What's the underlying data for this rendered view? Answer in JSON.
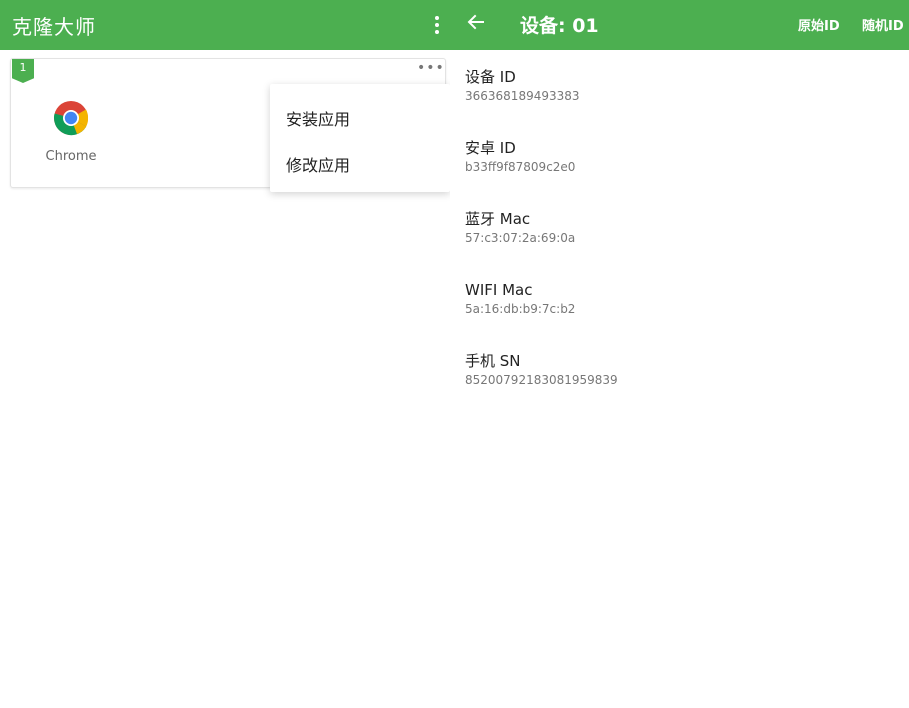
{
  "left": {
    "app_title": "克隆大师",
    "overflow_icon": "more-vert-icon",
    "card": {
      "badge": "1",
      "more_icon": "more-horiz-icon",
      "app_icon": "chrome-icon",
      "app_name": "Chrome"
    },
    "popup_menu": {
      "items": [
        {
          "label": "安装应用"
        },
        {
          "label": "修改应用"
        }
      ]
    }
  },
  "right": {
    "back_icon": "arrow-left-icon",
    "title": "设备: 01",
    "actions": [
      {
        "label": "原始ID"
      },
      {
        "label": "随机ID"
      }
    ],
    "fields": [
      {
        "label": "设备 ID",
        "value": "366368189493383"
      },
      {
        "label": "安卓 ID",
        "value": "b33ff9f87809c2e0"
      },
      {
        "label": "蓝牙 Mac",
        "value": "57:c3:07:2a:69:0a"
      },
      {
        "label": "WIFI Mac",
        "value": "5a:16:db:b9:7c:b2"
      },
      {
        "label": "手机 SN",
        "value": "85200792183081959839"
      }
    ]
  },
  "colors": {
    "primary_green": "#4caf50",
    "text_primary": "#222222",
    "text_secondary": "#777777"
  }
}
